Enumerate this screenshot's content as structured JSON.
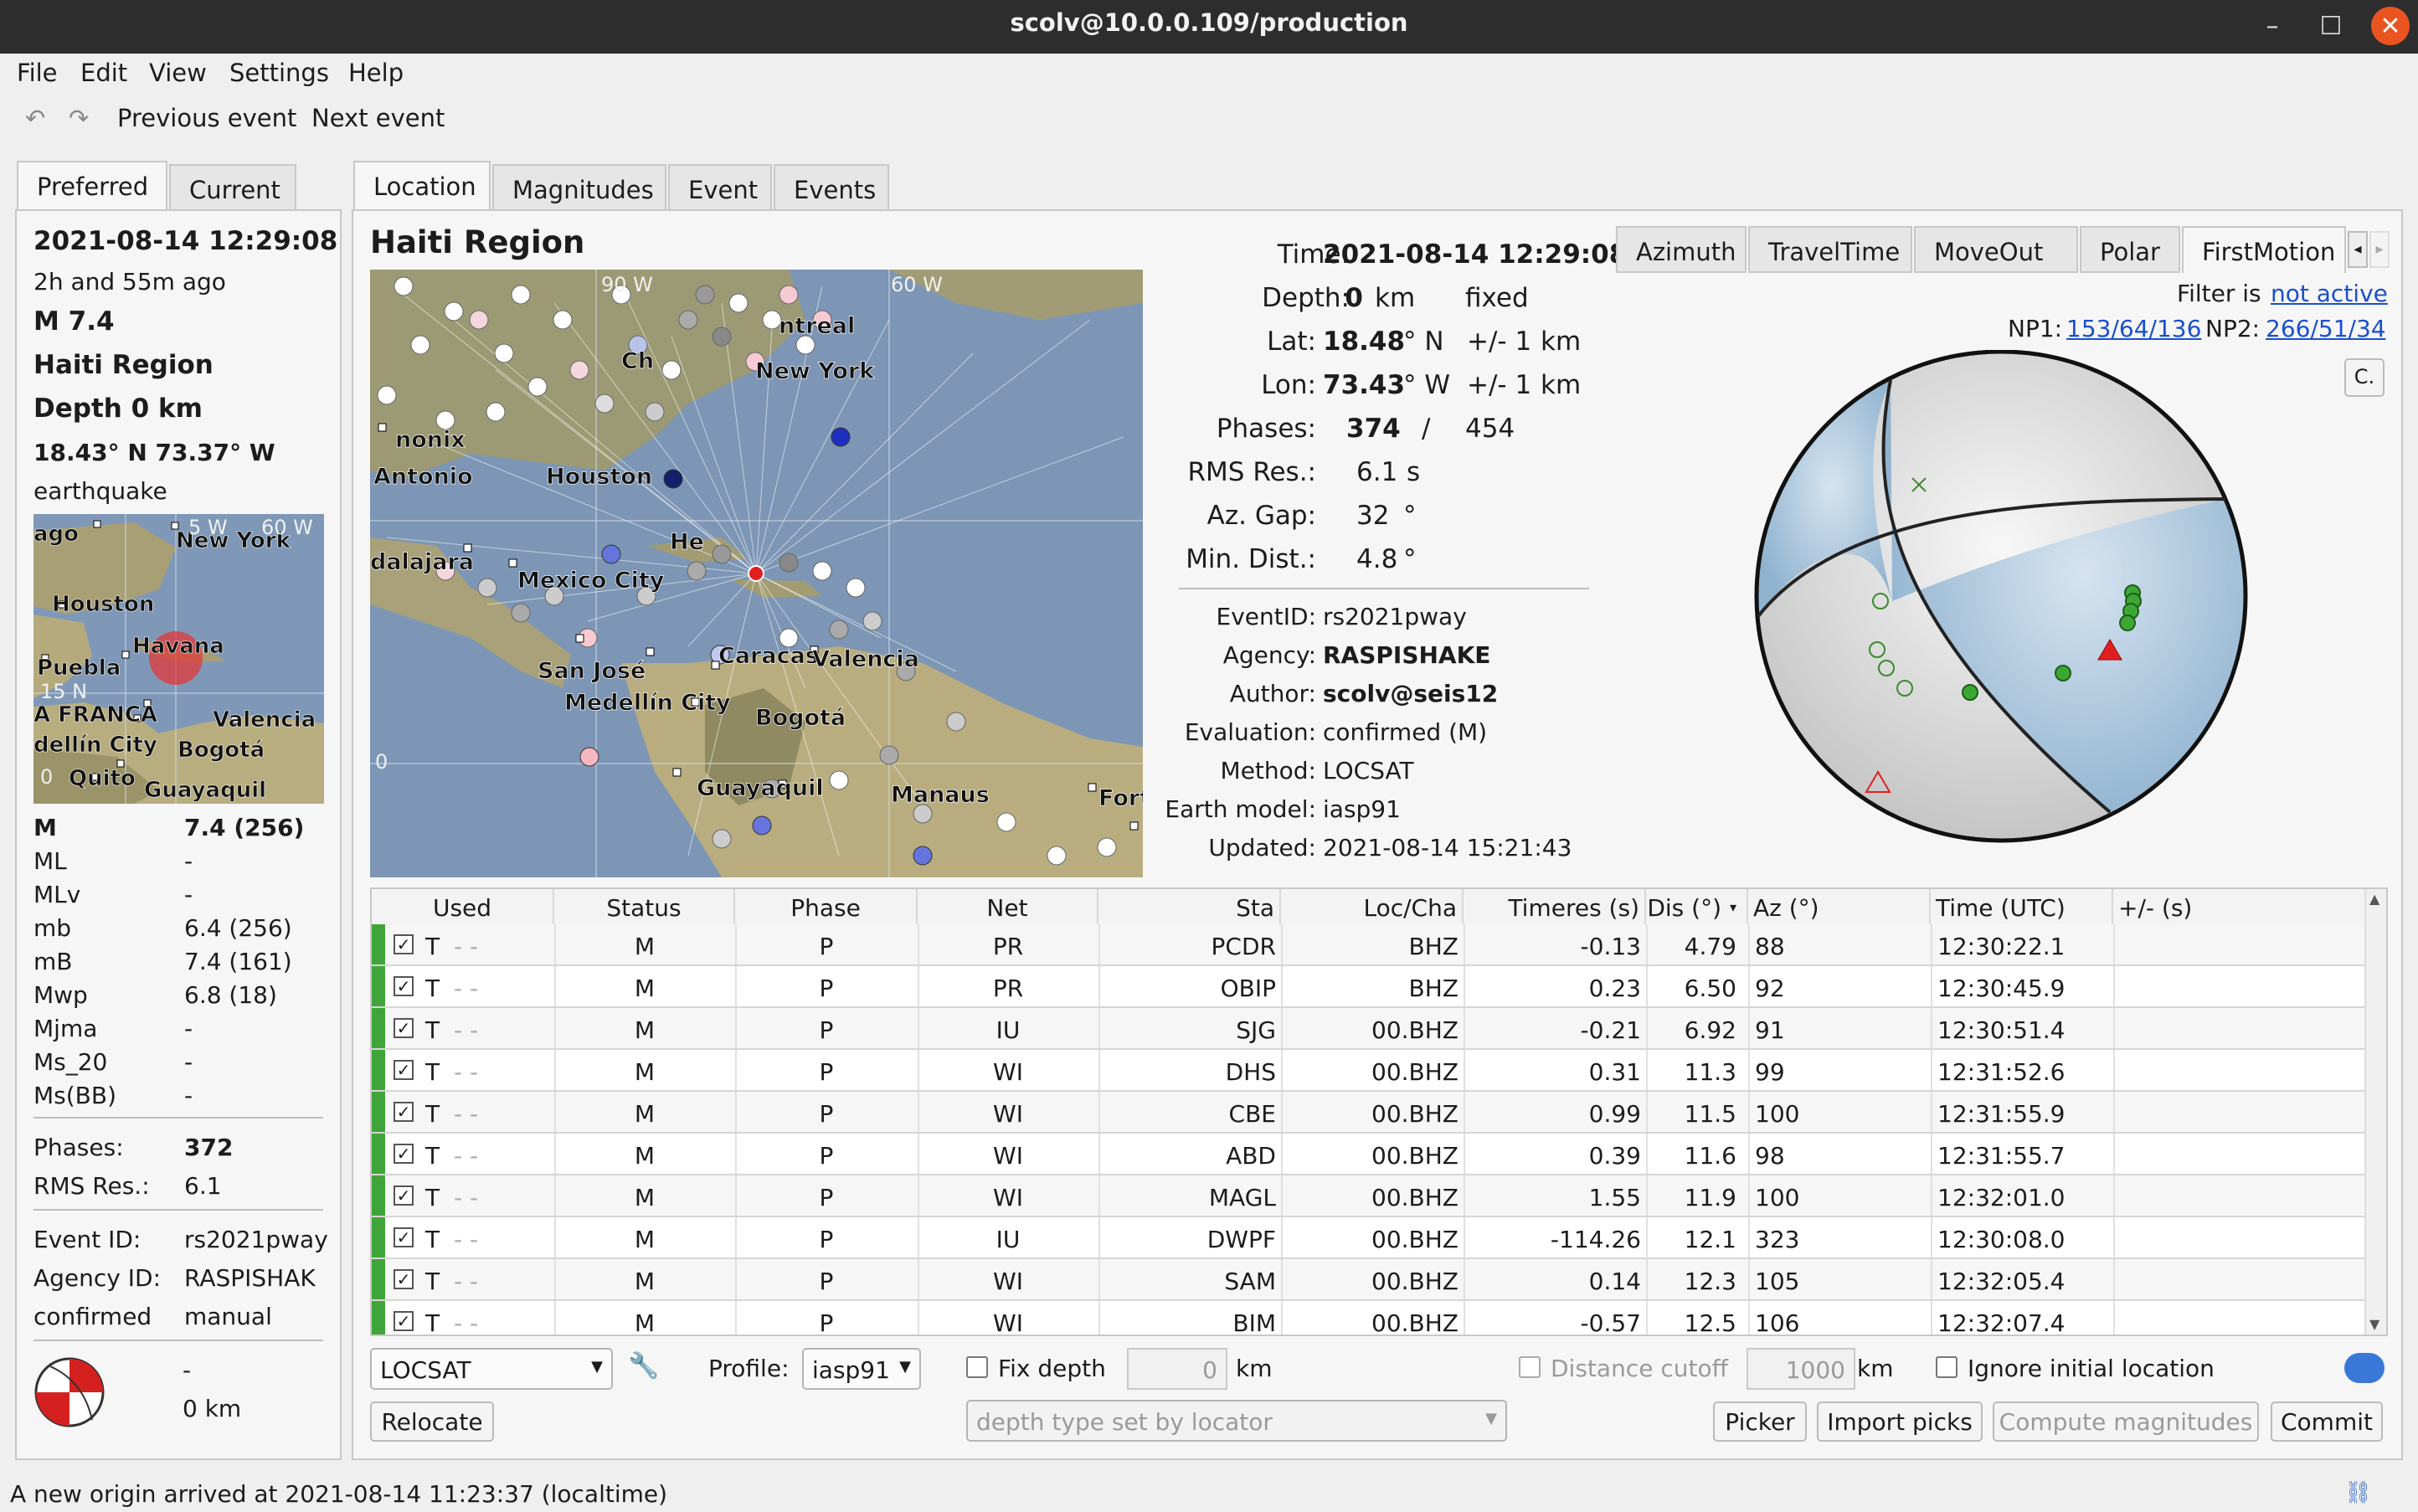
{
  "window": {
    "title": "scolv@10.0.0.109/production"
  },
  "menu": [
    "File",
    "Edit",
    "View",
    "Settings",
    "Help"
  ],
  "toolbar": {
    "prev": "Previous event",
    "next": "Next event"
  },
  "left": {
    "tabs": [
      "Preferred",
      "Current"
    ],
    "time": "2021-08-14 12:29:08",
    "ago": "2h and 55m ago",
    "mag": "M  7.4",
    "region": "Haiti Region",
    "depth": "Depth  0 km",
    "coords": "18.43° N  73.37° W",
    "type": "earthquake",
    "map_labels": [
      "ago",
      "New York",
      "Houston",
      "Havana",
      "Puebla",
      "A FRANCA",
      "Valencia",
      "dellín City",
      "Bogotá",
      "Quito",
      "Guayaquil",
      "15 N",
      "0",
      "5 W",
      "60 W"
    ],
    "magnitudes": [
      {
        "name": "M",
        "value": "7.4 (256)"
      },
      {
        "name": "ML",
        "value": "-"
      },
      {
        "name": "MLv",
        "value": "-"
      },
      {
        "name": "mb",
        "value": "6.4 (256)"
      },
      {
        "name": "mB",
        "value": "7.4 (161)"
      },
      {
        "name": "Mwp",
        "value": "6.8 (18)"
      },
      {
        "name": "Mjma",
        "value": "-"
      },
      {
        "name": "Ms_20",
        "value": "-"
      },
      {
        "name": "Ms(BB)",
        "value": "-"
      }
    ],
    "phases_label": "Phases:",
    "phases": "372",
    "rms_label": "RMS Res.:",
    "rms": "6.1",
    "eventid_label": "Event ID:",
    "eventid": "rs2021pway",
    "agency_label": "Agency ID:",
    "agency": "RASPISHAK",
    "status": "confirmed",
    "mode": "manual",
    "fm_value": "-",
    "fm_depth": "0 km"
  },
  "main": {
    "tabs": [
      "Location",
      "Magnitudes",
      "Event",
      "Events"
    ],
    "region": "Haiti Region",
    "map_labels": [
      "90 W",
      "60 W",
      "ntreal",
      "New York",
      "Ch",
      "nonix",
      "Antonio",
      "Houston",
      "dalajara",
      "Mexico City",
      "He",
      "San José",
      "Caracas",
      "Valencia",
      "Medellín City",
      "Bogotá",
      "Guayaquil",
      "Manaus",
      "Fort",
      "0"
    ],
    "info": {
      "time_label": "Time:",
      "time": "2021-08-14 12:29:08",
      "depth_label": "Depth:",
      "depth": "0",
      "depth_unit": "km",
      "depth_fixed": "fixed",
      "lat_label": "Lat:",
      "lat": "18.48",
      "lat_unit": "° N",
      "lat_err": "+/- 1",
      "lat_err_unit": "km",
      "lon_label": "Lon:",
      "lon": "73.43",
      "lon_unit": "° W",
      "lon_err": "+/- 1",
      "lon_err_unit": "km",
      "phases_label": "Phases:",
      "phases": "374",
      "phases_sep": "/",
      "phases_total": "454",
      "rms_label": "RMS Res.:",
      "rms": "6.1",
      "rms_unit": "s",
      "azgap_label": "Az. Gap:",
      "azgap": "32",
      "azgap_unit": "°",
      "mindist_label": "Min. Dist.:",
      "mindist": "4.8",
      "mindist_unit": "°",
      "eventid_label": "EventID:",
      "eventid": "rs2021pway",
      "agency_label": "Agency:",
      "agency": "RASPISHAKE",
      "author_label": "Author:",
      "author": "scolv@seis12",
      "eval_label": "Evaluation:",
      "eval": "confirmed (M)",
      "method_label": "Method:",
      "method": "LOCSAT",
      "model_label": "Earth model:",
      "model": "iasp91",
      "updated_label": "Updated:",
      "updated": "2021-08-14 15:21:43"
    },
    "plot_tabs": [
      "Azimuth",
      "TravelTime",
      "MoveOut",
      "Polar",
      "FirstMotion"
    ],
    "filter_label": "Filter is",
    "filter_value": "not active",
    "np1_label": "NP1:",
    "np1": "153/64/136",
    "np2_label": "NP2:",
    "np2": "266/51/34",
    "c_button": "C."
  },
  "table": {
    "headers": [
      "Used",
      "Status",
      "Phase",
      "Net",
      "Sta",
      "Loc/Cha",
      "Timeres (s)",
      "Dis (°)",
      "Az (°)",
      "Time (UTC)",
      "+/- (s)"
    ],
    "rows": [
      {
        "used": "T",
        "status": "M",
        "phase": "P",
        "net": "PR",
        "sta": "PCDR",
        "loc": "BHZ",
        "res": "-0.13",
        "dis": "4.79",
        "az": "88",
        "time": "12:30:22.1"
      },
      {
        "used": "T",
        "status": "M",
        "phase": "P",
        "net": "PR",
        "sta": "OBIP",
        "loc": "BHZ",
        "res": "0.23",
        "dis": "6.50",
        "az": "92",
        "time": "12:30:45.9"
      },
      {
        "used": "T",
        "status": "M",
        "phase": "P",
        "net": "IU",
        "sta": "SJG",
        "loc": "00.BHZ",
        "res": "-0.21",
        "dis": "6.92",
        "az": "91",
        "time": "12:30:51.4"
      },
      {
        "used": "T",
        "status": "M",
        "phase": "P",
        "net": "WI",
        "sta": "DHS",
        "loc": "00.BHZ",
        "res": "0.31",
        "dis": "11.3",
        "az": "99",
        "time": "12:31:52.6"
      },
      {
        "used": "T",
        "status": "M",
        "phase": "P",
        "net": "WI",
        "sta": "CBE",
        "loc": "00.BHZ",
        "res": "0.99",
        "dis": "11.5",
        "az": "100",
        "time": "12:31:55.9"
      },
      {
        "used": "T",
        "status": "M",
        "phase": "P",
        "net": "WI",
        "sta": "ABD",
        "loc": "00.BHZ",
        "res": "0.39",
        "dis": "11.6",
        "az": "98",
        "time": "12:31:55.7"
      },
      {
        "used": "T",
        "status": "M",
        "phase": "P",
        "net": "WI",
        "sta": "MAGL",
        "loc": "00.BHZ",
        "res": "1.55",
        "dis": "11.9",
        "az": "100",
        "time": "12:32:01.0"
      },
      {
        "used": "T",
        "status": "M",
        "phase": "P",
        "net": "IU",
        "sta": "DWPF",
        "loc": "00.BHZ",
        "res": "-114.26",
        "dis": "12.1",
        "az": "323",
        "time": "12:30:08.0"
      },
      {
        "used": "T",
        "status": "M",
        "phase": "P",
        "net": "WI",
        "sta": "SAM",
        "loc": "00.BHZ",
        "res": "0.14",
        "dis": "12.3",
        "az": "105",
        "time": "12:32:05.4"
      },
      {
        "used": "T",
        "status": "M",
        "phase": "P",
        "net": "WI",
        "sta": "BIM",
        "loc": "00.BHZ",
        "res": "-0.57",
        "dis": "12.5",
        "az": "106",
        "time": "12:32:07.4"
      }
    ]
  },
  "controls": {
    "locator": "LOCSAT",
    "profile_label": "Profile:",
    "profile": "iasp91",
    "fixdepth_label": "Fix depth",
    "depth_value": "0",
    "depth_unit": "km",
    "distcutoff_label": "Distance cutoff",
    "distcutoff_value": "1000",
    "dist_unit": "km",
    "ignore_label": "Ignore initial location",
    "relocate": "Relocate",
    "depthtype": "depth type set by locator",
    "picker": "Picker",
    "import": "Import picks",
    "compute": "Compute magnitudes",
    "commit": "Commit"
  },
  "status": {
    "message": "A new origin arrived at 2021-08-14 11:23:37 (localtime)"
  },
  "colors": {
    "accent": "#e95420",
    "used_bar": "#3fa53a",
    "link": "#1a4fd0"
  }
}
